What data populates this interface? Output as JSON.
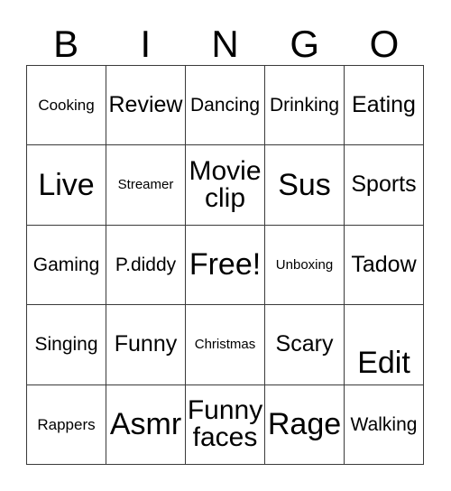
{
  "card": {
    "title": "BINGO",
    "header_letters": [
      "B",
      "I",
      "N",
      "G",
      "O"
    ],
    "free_space_label": "Free!",
    "grid_size": "5x5",
    "border_color": "#3a3a3a",
    "background_color": "#ffffff",
    "text_color": "#000000"
  },
  "rows": [
    {
      "cells": [
        {
          "label": "Cooking",
          "size": "fs-s"
        },
        {
          "label": "Review",
          "size": "fs-l"
        },
        {
          "label": "Dancing",
          "size": "fs-m"
        },
        {
          "label": "Drinking",
          "size": "fs-m"
        },
        {
          "label": "Eating",
          "size": "fs-l"
        }
      ]
    },
    {
      "cells": [
        {
          "label": "Live",
          "size": "fs-xxl"
        },
        {
          "label": "Streamer",
          "size": "fs-xs"
        },
        {
          "label": "Movie\nclip",
          "size": "fs-xl"
        },
        {
          "label": "Sus",
          "size": "fs-xxl"
        },
        {
          "label": "Sports",
          "size": "fs-l"
        }
      ]
    },
    {
      "cells": [
        {
          "label": "Gaming",
          "size": "fs-m"
        },
        {
          "label": "P.diddy",
          "size": "fs-m"
        },
        {
          "label": "Free!",
          "size": "fs-xxl"
        },
        {
          "label": "Unboxing",
          "size": "fs-xs"
        },
        {
          "label": "Tadow",
          "size": "fs-l"
        }
      ]
    },
    {
      "cells": [
        {
          "label": "Singing",
          "size": "fs-m"
        },
        {
          "label": "Funny",
          "size": "fs-l"
        },
        {
          "label": "Christmas",
          "size": "fs-xs"
        },
        {
          "label": "Scary",
          "size": "fs-l"
        },
        {
          "label": "Edit",
          "size": "fs-xxl",
          "valign": "bottom"
        }
      ]
    },
    {
      "cells": [
        {
          "label": "Rappers",
          "size": "fs-s"
        },
        {
          "label": "Asmr",
          "size": "fs-xxl"
        },
        {
          "label": "Funny\nfaces",
          "size": "fs-xl"
        },
        {
          "label": "Rage",
          "size": "fs-xxl"
        },
        {
          "label": "Walking",
          "size": "fs-m"
        }
      ]
    }
  ]
}
